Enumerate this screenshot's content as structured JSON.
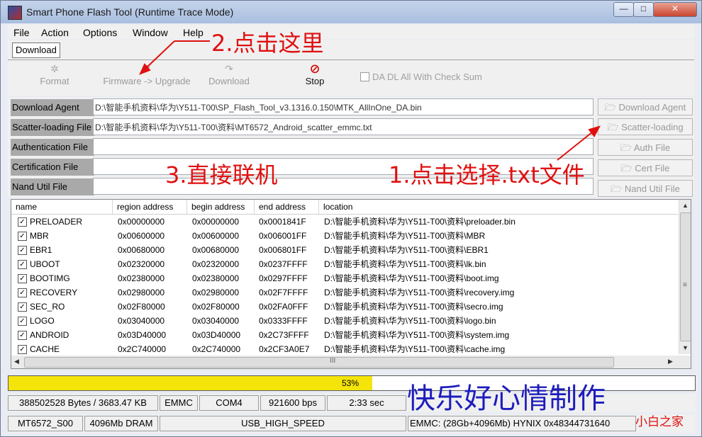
{
  "window": {
    "title": "Smart Phone Flash Tool (Runtime Trace Mode)",
    "minimize": "—",
    "maximize": "□",
    "close": "✕"
  },
  "menu": [
    "File",
    "Action",
    "Options",
    "Window",
    "Help"
  ],
  "tab": "Download",
  "toolbar": {
    "format": "Format",
    "firmware_upgrade": "Firmware -> Upgrade",
    "download": "Download",
    "stop": "Stop",
    "da_checkbox_label": "DA DL All With Check Sum"
  },
  "form": {
    "download_agent": {
      "label": "Download Agent",
      "value": "D:\\智能手机资料\\华为\\Y511-T00\\SP_Flash_Tool_v3.1316.0.150\\MTK_AllInOne_DA.bin",
      "button": "Download Agent"
    },
    "scatter": {
      "label": "Scatter-loading File",
      "value": "D:\\智能手机资料\\华为\\Y511-T00\\资料\\MT6572_Android_scatter_emmc.txt",
      "button": "Scatter-loading"
    },
    "auth": {
      "label": "Authentication File",
      "value": "",
      "button": "Auth File"
    },
    "cert": {
      "label": "Certification File",
      "value": "",
      "button": "Cert File"
    },
    "nand": {
      "label": "Nand Util File",
      "value": "",
      "button": "Nand Util File"
    }
  },
  "table": {
    "columns": [
      "name",
      "region address",
      "begin address",
      "end address",
      "location"
    ],
    "rows": [
      {
        "checked": true,
        "name": "PRELOADER",
        "region": "0x00000000",
        "begin": "0x00000000",
        "end": "0x0001841F",
        "location": "D:\\智能手机资料\\华为\\Y511-T00\\资料\\preloader.bin"
      },
      {
        "checked": true,
        "name": "MBR",
        "region": "0x00600000",
        "begin": "0x00600000",
        "end": "0x006001FF",
        "location": "D:\\智能手机资料\\华为\\Y511-T00\\资料\\MBR"
      },
      {
        "checked": true,
        "name": "EBR1",
        "region": "0x00680000",
        "begin": "0x00680000",
        "end": "0x006801FF",
        "location": "D:\\智能手机资料\\华为\\Y511-T00\\资料\\EBR1"
      },
      {
        "checked": true,
        "name": "UBOOT",
        "region": "0x02320000",
        "begin": "0x02320000",
        "end": "0x0237FFFF",
        "location": "D:\\智能手机资料\\华为\\Y511-T00\\资料\\lk.bin"
      },
      {
        "checked": true,
        "name": "BOOTIMG",
        "region": "0x02380000",
        "begin": "0x02380000",
        "end": "0x0297FFFF",
        "location": "D:\\智能手机资料\\华为\\Y511-T00\\资料\\boot.img"
      },
      {
        "checked": true,
        "name": "RECOVERY",
        "region": "0x02980000",
        "begin": "0x02980000",
        "end": "0x02F7FFFF",
        "location": "D:\\智能手机资料\\华为\\Y511-T00\\资料\\recovery.img"
      },
      {
        "checked": true,
        "name": "SEC_RO",
        "region": "0x02F80000",
        "begin": "0x02F80000",
        "end": "0x02FA0FFF",
        "location": "D:\\智能手机资料\\华为\\Y511-T00\\资料\\secro.img"
      },
      {
        "checked": true,
        "name": "LOGO",
        "region": "0x03040000",
        "begin": "0x03040000",
        "end": "0x0333FFFF",
        "location": "D:\\智能手机资料\\华为\\Y511-T00\\资料\\logo.bin"
      },
      {
        "checked": true,
        "name": "ANDROID",
        "region": "0x03D40000",
        "begin": "0x03D40000",
        "end": "0x2C73FFFF",
        "location": "D:\\智能手机资料\\华为\\Y511-T00\\资料\\system.img"
      },
      {
        "checked": true,
        "name": "CACHE",
        "region": "0x2C740000",
        "begin": "0x2C740000",
        "end": "0x2CF3A0E7",
        "location": "D:\\智能手机资料\\华为\\Y511-T00\\资料\\cache.img"
      }
    ]
  },
  "scroll": {
    "h_grip": "III"
  },
  "progress": {
    "percent": 53,
    "text": "53%"
  },
  "status": {
    "bytes": "388502528 Bytes / 3683.47 KB",
    "storage": "EMMC",
    "port": "COM4",
    "baud": "921600 bps",
    "time": "2:33 sec",
    "chip": "MT6572_S00",
    "dram": "4096Mb DRAM",
    "speed": "USB_HIGH_SPEED",
    "emmc_info": "EMMC: (28Gb+4096Mb) HYNIX 0x48344731640"
  },
  "annotations": {
    "step2": "2.点击这里",
    "step3": "3.直接联机",
    "step1": "1.点击选择.txt文件",
    "watermark": "快乐好心情制作",
    "corner": "小白之家"
  },
  "colors": {
    "progress_fill": "#f5e40a",
    "annotation": "#e01010",
    "watermark": "#1d1dbd"
  }
}
